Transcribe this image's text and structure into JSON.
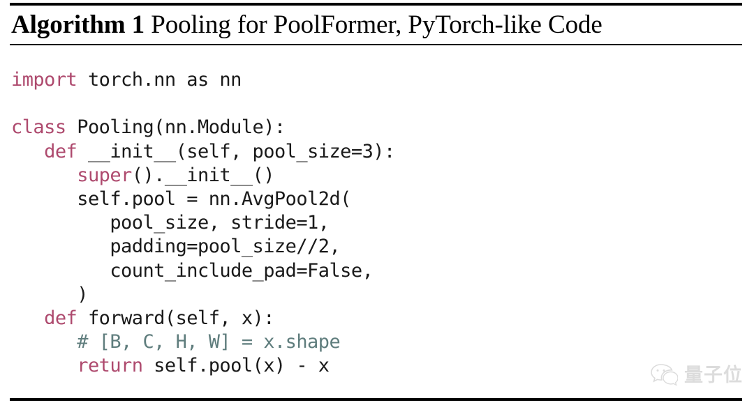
{
  "algorithm": {
    "title_number": "Algorithm 1",
    "title_text": " Pooling for PoolFormer, PyTorch-like Code",
    "rules": {
      "top": "thick-rule",
      "middle": "thin-rule",
      "bottom": "thick-rule"
    }
  },
  "code": {
    "language": "python",
    "colors": {
      "keyword": "#ae4a6e",
      "comment": "#5f7d7d",
      "text": "#1a1a1a",
      "background": "#ffffff"
    },
    "lines": [
      {
        "id": "l1",
        "tokens": [
          {
            "t": "import",
            "c": "kw"
          },
          {
            "t": " torch.nn as nn",
            "c": "plain"
          }
        ]
      },
      {
        "id": "l2",
        "tokens": [
          {
            "t": "",
            "c": "plain"
          }
        ]
      },
      {
        "id": "l3",
        "tokens": [
          {
            "t": "class",
            "c": "kw"
          },
          {
            "t": " Pooling(nn.Module):",
            "c": "plain"
          }
        ]
      },
      {
        "id": "l4",
        "tokens": [
          {
            "t": "   ",
            "c": "plain"
          },
          {
            "t": "def",
            "c": "kw"
          },
          {
            "t": " __init__(self, pool_size=3):",
            "c": "plain"
          }
        ]
      },
      {
        "id": "l5",
        "tokens": [
          {
            "t": "      ",
            "c": "plain"
          },
          {
            "t": "super",
            "c": "kw"
          },
          {
            "t": "().__init__()",
            "c": "plain"
          }
        ]
      },
      {
        "id": "l6",
        "tokens": [
          {
            "t": "      self.pool = nn.AvgPool2d(",
            "c": "plain"
          }
        ]
      },
      {
        "id": "l7",
        "tokens": [
          {
            "t": "         pool_size, stride=1,",
            "c": "plain"
          }
        ]
      },
      {
        "id": "l8",
        "tokens": [
          {
            "t": "         padding=pool_size//2,",
            "c": "plain"
          }
        ]
      },
      {
        "id": "l9",
        "tokens": [
          {
            "t": "         count_include_pad=False,",
            "c": "plain"
          }
        ]
      },
      {
        "id": "l10",
        "tokens": [
          {
            "t": "      )",
            "c": "plain"
          }
        ]
      },
      {
        "id": "l11",
        "tokens": [
          {
            "t": "   ",
            "c": "plain"
          },
          {
            "t": "def",
            "c": "kw"
          },
          {
            "t": " forward(self, x):",
            "c": "plain"
          }
        ]
      },
      {
        "id": "l12",
        "tokens": [
          {
            "t": "      ",
            "c": "plain"
          },
          {
            "t": "# [B, C, H, W] = x.shape",
            "c": "cmt"
          }
        ]
      },
      {
        "id": "l13",
        "tokens": [
          {
            "t": "      ",
            "c": "plain"
          },
          {
            "t": "return",
            "c": "kw"
          },
          {
            "t": " self.pool(x) - x",
            "c": "plain"
          }
        ]
      }
    ]
  },
  "watermark": {
    "icon": "wechat-icon",
    "text": "量子位"
  }
}
